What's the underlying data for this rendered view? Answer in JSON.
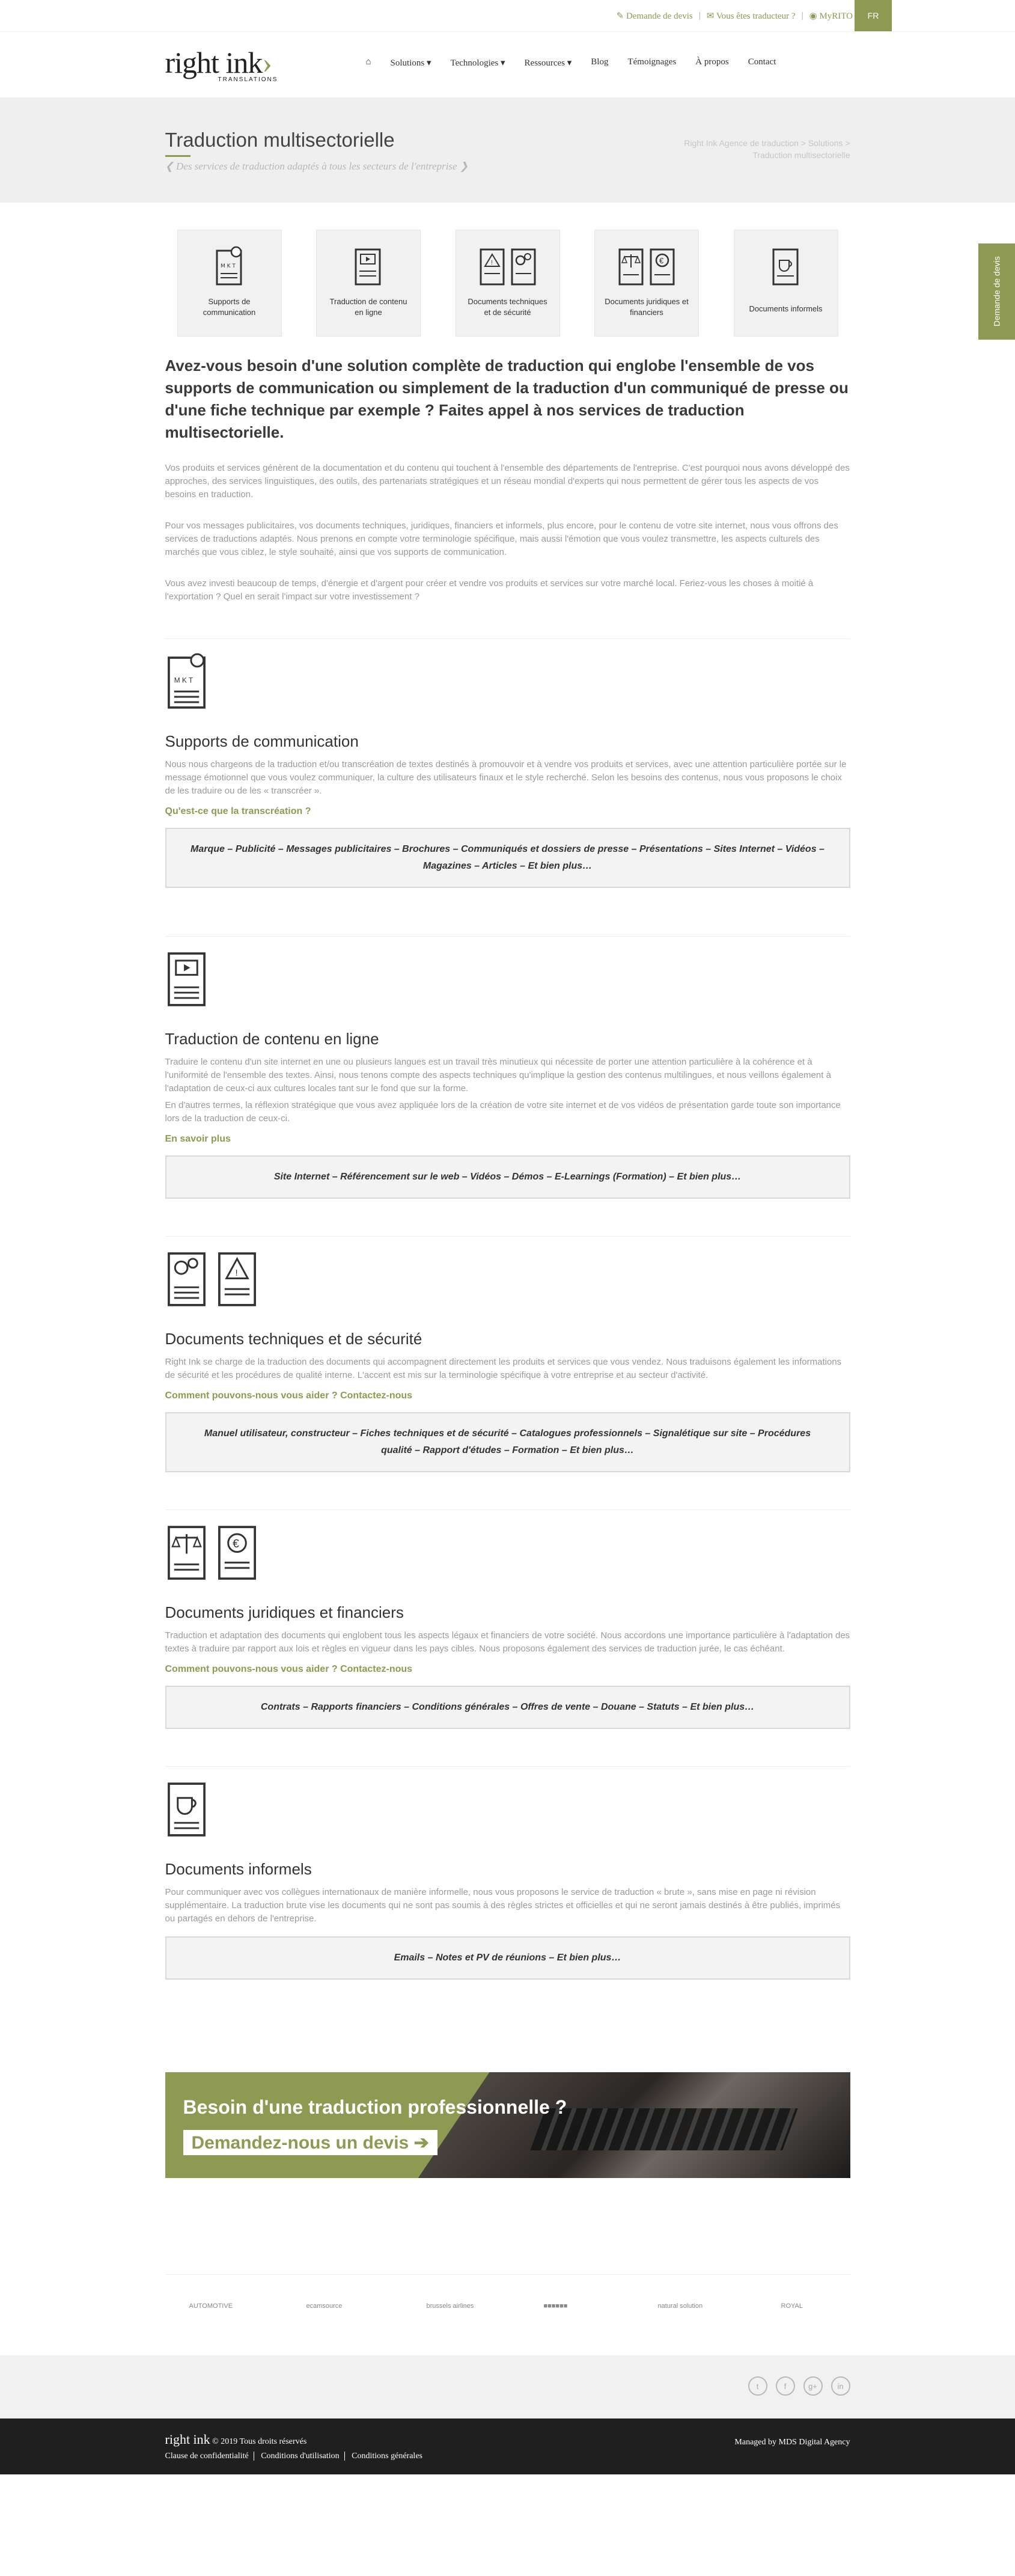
{
  "topbar": {
    "quote": "Demande de devis",
    "translator": "Vous êtes traducteur ?",
    "myrito": "MyRITO",
    "lang": "FR"
  },
  "logo": {
    "name": "right ink",
    "sub": "TRANSLATIONS"
  },
  "nav": [
    "Solutions ▾",
    "Technologies ▾",
    "Ressources ▾",
    "Blog",
    "Témoignages",
    "À propos",
    "Contact"
  ],
  "banner": {
    "title": "Traduction multisectorielle",
    "tagline": "❮ Des services de traduction adaptés à tous les secteurs de l'entreprise ❯",
    "crumb": "Right Ink Agence de traduction > Solutions > Traduction multisectorielle"
  },
  "sidetab": "Demande de devis",
  "tabs": [
    "Supports de communication",
    "Traduction de contenu en ligne",
    "Documents techniques et de sécurité",
    "Documents juridiques et financiers",
    "Documents informels"
  ],
  "intro": {
    "lead": "Avez-vous besoin d'une solution complète de traduction qui englobe l'ensemble de vos supports de communication ou simplement de la traduction d'un communiqué de presse ou d'une fiche technique par exemple ? Faites appel à nos services de traduction multisectorielle.",
    "p1": "Vos produits et services génèrent de la documentation et du contenu qui touchent à l'ensemble des départements de l'entreprise. C'est pourquoi nous avons développé des approches, des services linguistiques, des outils, des partenariats stratégiques et un réseau mondial d'experts qui nous permettent de gérer tous les aspects de vos besoins en traduction.",
    "p2": "Pour vos messages publicitaires, vos documents techniques, juridiques, financiers et informels, plus encore, pour le contenu de votre site internet, nous vous offrons des services de traductions adaptés. Nous prenons en compte votre terminologie spécifique, mais aussi l'émotion que vous voulez transmettre, les aspects culturels des marchés que vous ciblez, le style souhaité, ainsi que vos supports de communication.",
    "p3": "Vous avez investi beaucoup de temps, d'énergie et d'argent pour créer et vendre vos produits et services sur votre marché local. Feriez-vous les choses à moitié à l'exportation ? Quel en serait l'impact sur votre investissement ?"
  },
  "sections": [
    {
      "title": "Supports de communication",
      "text": "Nous nous chargeons de la traduction et/ou transcréation de textes destinés à promouvoir et à vendre vos produits et services, avec une attention particulière portée sur le message émotionnel que vous voulez communiquer, la culture des utilisateurs finaux et le style recherché. Selon les besoins des contenus, nous vous proposons le choix de les traduire ou de les « transcréer ».",
      "text2": "",
      "link": "Qu'est-ce que la transcréation ?",
      "box": "Marque – Publicité – Messages publicitaires – Brochures – Communiqués et dossiers de presse – Présentations – Sites Internet – Vidéos – Magazines – Articles – Et bien plus…"
    },
    {
      "title": "Traduction de contenu en ligne",
      "text": "Traduire le contenu d'un site internet en une ou plusieurs langues est un travail très minutieux qui nécessite de porter une attention particulière à la cohérence et à l'uniformité de l'ensemble des textes. Ainsi, nous tenons compte des aspects techniques qu'implique la gestion des contenus multilingues, et nous veillons également à l'adaptation de ceux-ci aux cultures locales tant sur le fond que sur la forme.",
      "text2": "En d'autres termes, la réflexion stratégique que vous avez appliquée lors de la création de votre site internet et de vos vidéos de présentation garde toute son importance lors de la traduction de ceux-ci.",
      "link": "En savoir plus",
      "box": "Site Internet – Référencement sur le web – Vidéos – Démos – E-Learnings (Formation) – Et bien plus…"
    },
    {
      "title": "Documents techniques et de sécurité",
      "text": "Right Ink se charge de la traduction des documents qui accompagnent directement les produits et services que vous vendez. Nous traduisons également les informations de sécurité et les procédures de qualité interne. L'accent est mis sur la terminologie spécifique à votre entreprise et au secteur d'activité.",
      "text2": "",
      "link": "Comment pouvons-nous vous aider ? Contactez-nous",
      "box": "Manuel utilisateur, constructeur – Fiches techniques et de sécurité – Catalogues professionnels – Signalétique sur site – Procédures qualité – Rapport d'études – Formation – Et bien plus…"
    },
    {
      "title": "Documents juridiques et financiers",
      "text": "Traduction et adaptation des documents qui englobent tous les aspects légaux et financiers de votre société. Nous accordons une importance particulière à l'adaptation des textes à traduire par rapport aux lois et règles en vigueur dans les pays cibles. Nous proposons également des services de traduction jurée, le cas échéant.",
      "text2": "",
      "link": "Comment pouvons-nous vous aider ? Contactez-nous",
      "box": "Contrats – Rapports financiers – Conditions générales – Offres de vente – Douane – Statuts – Et bien plus…"
    },
    {
      "title": "Documents informels",
      "text": "Pour communiquer avec vos collègues internationaux de manière informelle, nous vous proposons le service de traduction « brute », sans mise en page ni révision supplémentaire. La traduction brute vise les documents qui ne sont pas soumis à des règles strictes et officielles et qui ne seront jamais destinés à être publiés, imprimés ou partagés en dehors de l'entreprise.",
      "text2": "",
      "link": "",
      "box": "Emails – Notes et PV de réunions – Et bien plus…"
    }
  ],
  "cta": {
    "title": "Besoin d'une traduction professionnelle ?",
    "button": "Demandez-nous un devis ➔"
  },
  "partners": [
    "AUTOMOTIVE",
    "ecamsource",
    "brussels airlines",
    "■■■■■■",
    "natural solution",
    "ROYAL"
  ],
  "social": [
    "t",
    "f",
    "g+",
    "in"
  ],
  "footer": {
    "name": "right ink",
    "copy": "© 2019  Tous droits réservés",
    "links": [
      "Clause de confidentialité",
      "Conditions d'utilisation",
      "Conditions générales"
    ],
    "managed": "Managed by MDS Digital Agency"
  },
  "colors": {
    "accent": "#8e9a51",
    "footer": "#1f1f1f"
  }
}
